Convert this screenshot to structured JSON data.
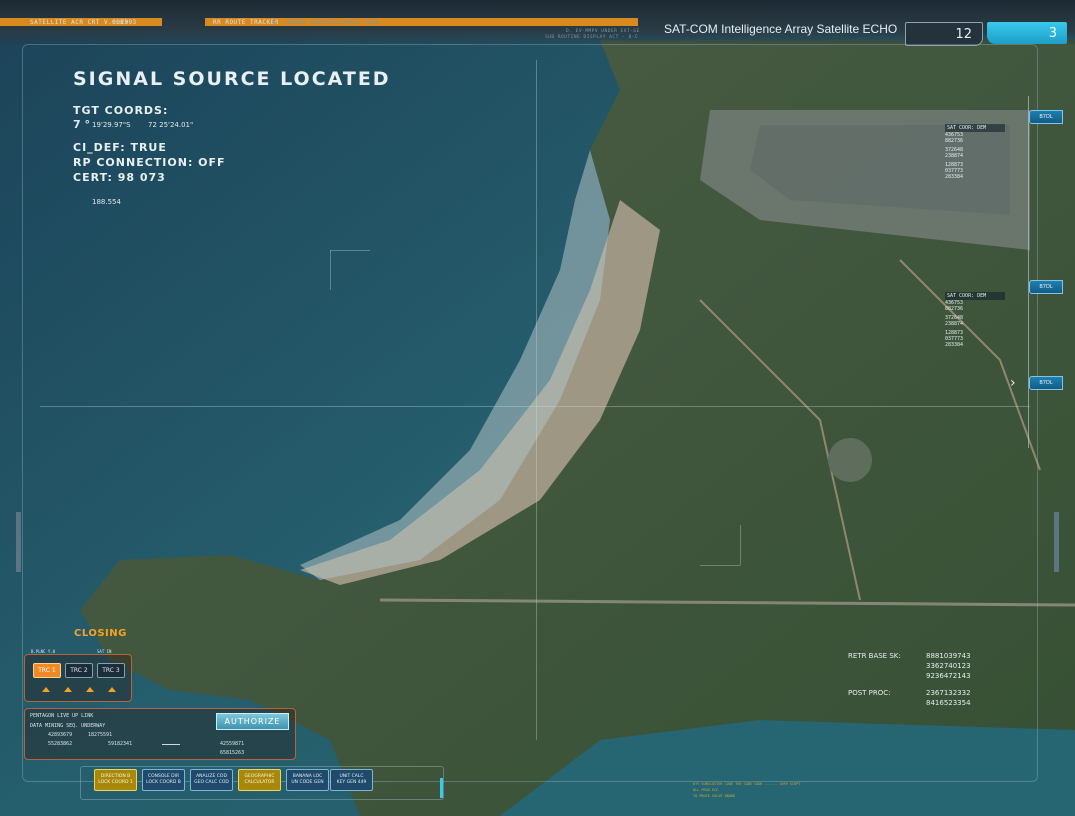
{
  "topbar": {
    "left_label": "SATELLITE ACR CRT V.0029",
    "left_code": "CLK393",
    "tracker_label": "RR ROUTE TRACKER",
    "tracker_sub": "D. UNDER SURVEILLANCE TASK",
    "right_small_1": "D. EV-MMPV UNDER EXT-GE",
    "right_small_2": "SUB ROUTINE DISPLAY ACT - 8-C",
    "sat_title": "SAT-COM Intelligence Array Satellite ECHO",
    "counter_a": "12",
    "counter_b": "3"
  },
  "main": {
    "headline": "SIGNAL  SOURCE LOCATED",
    "tgt_label": "TGT COORDS:",
    "tgt_deg": "7 °",
    "tgt_lat": "19'29.97\"S",
    "tgt_lon": "72 25'24.01\"",
    "ci_def": "CI_DEF: TRUE",
    "rp_connection": "RP CONNECTION: OFF",
    "cert": "CERT: 98 073",
    "readout": "188.554"
  },
  "sat_panels": [
    {
      "header": "SAT COOR: DEM",
      "lines": [
        "436753",
        "882736",
        "372648",
        "238874",
        "128873",
        "037773",
        "283384"
      ]
    },
    {
      "header": "SAT COOR: DEM",
      "lines": [
        "436753",
        "882736",
        "372648",
        "238874",
        "128873",
        "037773",
        "283384"
      ]
    }
  ],
  "sat_tabs": [
    "B7DL",
    "B7DL",
    "B7DL"
  ],
  "closing_label": "CLOSING",
  "trc": {
    "left_caption": "B.PLNC Y.0",
    "right_caption": "SAT IN",
    "buttons": [
      "TRC 1",
      "TRC 2",
      "TRC 3"
    ]
  },
  "link_panel": {
    "title": "PENTAGON LIVE UP LINK",
    "sub": "DATA MINING SEQ. UNDERWAY",
    "n1": "42893679",
    "n2": "18275591",
    "n3": "55283862",
    "n4": "59182341",
    "n5": "42559871",
    "n6": "65815263",
    "authorize": "AUTHORIZE"
  },
  "bottom_buttons": [
    {
      "l1": "DIRECTION B",
      "l2": "LOCK COORD 1",
      "style": "yellow"
    },
    {
      "l1": "CONSOLE DIR",
      "l2": "LOCK COORD B",
      "style": "blue"
    },
    {
      "l1": "ANALIZE COD",
      "l2": "GEO CALC COD",
      "style": "blue"
    },
    {
      "l1": "GEOGRAPHIC",
      "l2": "CALCULATOR",
      "style": "yellow"
    },
    {
      "l1": "BANANA LOC",
      "l2": "UN CODE GEN",
      "style": "blue"
    },
    {
      "l1": "UNIT CALC",
      "l2": "KEY GEN 449",
      "style": "blue"
    }
  ],
  "retr": {
    "base_label": "RETR BASE SK:",
    "base_values": [
      "8881039743",
      "3362740123",
      "9236472143"
    ],
    "post_label": "POST PROC:",
    "post_values": [
      "2367132332",
      "8416523354"
    ]
  },
  "footer": {
    "line1": "RTY SUBCLUSTER CODE THE CODE CODE ------ 1099 SCRPT",
    "line2": "ALL PROG ECE",
    "line3": "TO PROCE VALUE 8B0B8"
  },
  "colors": {
    "accent_orange": "#f08a22",
    "accent_cyan": "#38c9ec",
    "panel_border": "#b8633a"
  }
}
